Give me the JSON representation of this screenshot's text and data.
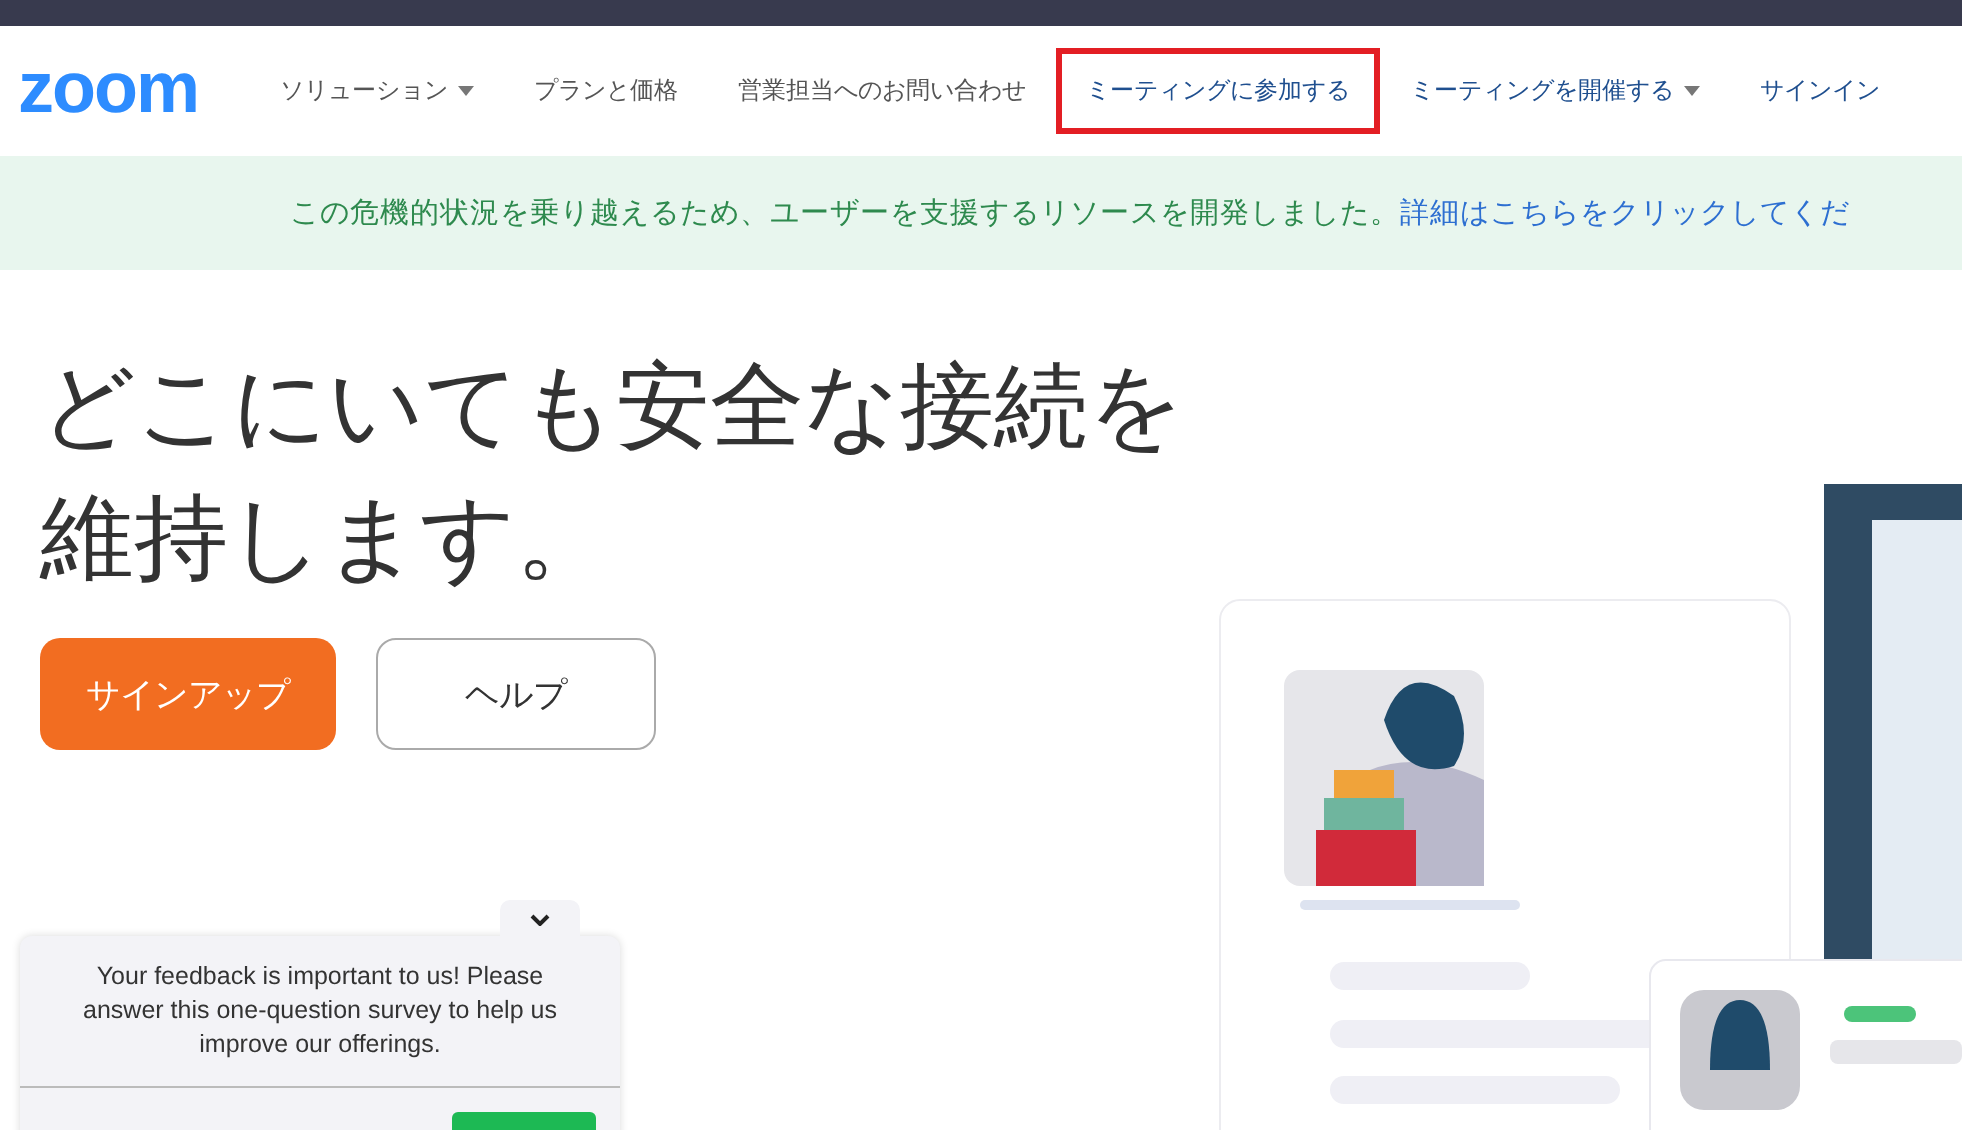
{
  "header": {
    "logo": "zoom",
    "nav": [
      {
        "label": "ソリューション",
        "kind": "plain",
        "has_menu": true,
        "highlighted": false
      },
      {
        "label": "プランと価格",
        "kind": "plain",
        "has_menu": false,
        "highlighted": false
      },
      {
        "label": "営業担当へのお問い合わせ",
        "kind": "plain",
        "has_menu": false,
        "highlighted": false
      },
      {
        "label": "ミーティングに参加する",
        "kind": "accent",
        "has_menu": false,
        "highlighted": true
      },
      {
        "label": "ミーティングを開催する",
        "kind": "accent",
        "has_menu": true,
        "highlighted": false
      },
      {
        "label": "サインイン",
        "kind": "accent",
        "has_menu": false,
        "highlighted": false
      }
    ]
  },
  "banner": {
    "text": "この危機的状況を乗り越えるため、ユーザーを支援するリソースを開発しました。",
    "link": "詳細はこちらをクリックしてくだ"
  },
  "hero": {
    "title_lines": [
      "どこにいても安全な接続を",
      "維持します。"
    ],
    "buttons": [
      {
        "label": "サインアップ",
        "kind": "primary"
      },
      {
        "label": "ヘルプ",
        "kind": "secondary"
      }
    ]
  },
  "feedback": {
    "text": "Your feedback is important to us! Please answer this one-question survey to help us improve our offerings."
  }
}
